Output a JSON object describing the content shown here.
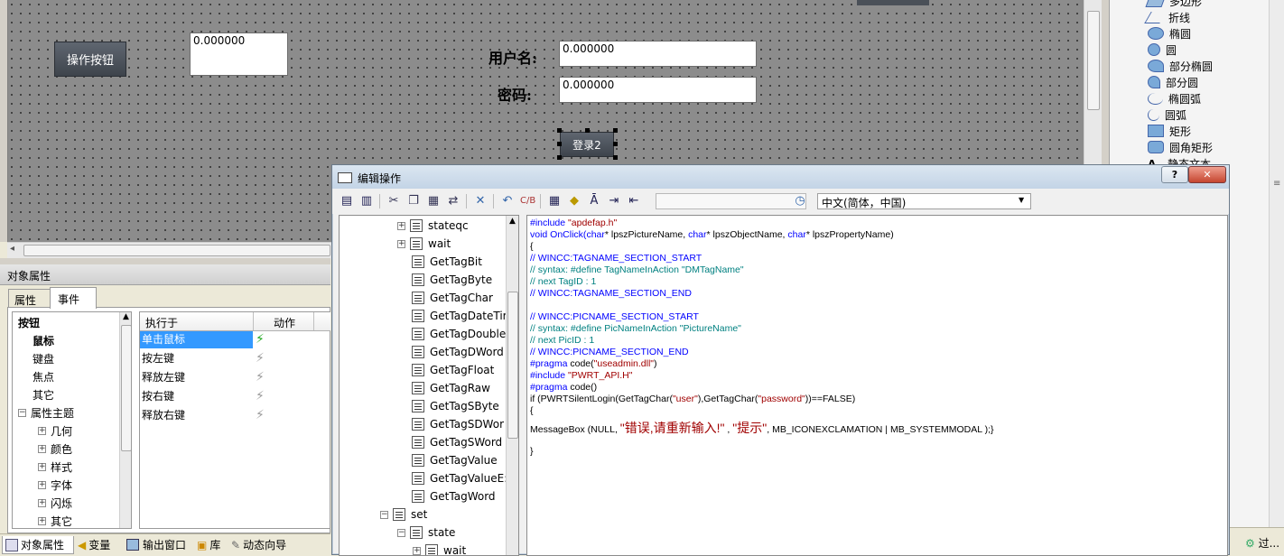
{
  "canvas": {
    "op_button_label": "操作按钮",
    "value_box": "0.000000",
    "username_label": "用户名:",
    "username_value": "0.000000",
    "password_label": "密码:",
    "password_value": "0.000000",
    "login_button_label": "登录2"
  },
  "toolbox": {
    "items": [
      {
        "label": "多边形",
        "icon": "polygon-icon"
      },
      {
        "label": "折线",
        "icon": "polyline-icon"
      },
      {
        "label": "椭圆",
        "icon": "ellipse-icon"
      },
      {
        "label": "圆",
        "icon": "circle-icon"
      },
      {
        "label": "部分椭圆",
        "icon": "partial-ellipse-icon"
      },
      {
        "label": "部分圆",
        "icon": "partial-circle-icon"
      },
      {
        "label": "椭圆弧",
        "icon": "elliptic-arc-icon"
      },
      {
        "label": "圆弧",
        "icon": "arc-icon"
      },
      {
        "label": "矩形",
        "icon": "rectangle-icon"
      },
      {
        "label": "圆角矩形",
        "icon": "rounded-rectangle-icon"
      },
      {
        "label": "静态文本",
        "icon": "static-text-icon"
      }
    ]
  },
  "properties": {
    "panel_title": "对象属性",
    "tabs": [
      "属性",
      "事件"
    ],
    "active_tab": "事件",
    "tree": [
      {
        "label": "按钮",
        "level": 0
      },
      {
        "label": "鼠标",
        "level": 1
      },
      {
        "label": "键盘",
        "level": 1
      },
      {
        "label": "焦点",
        "level": 1
      },
      {
        "label": "其它",
        "level": 1
      },
      {
        "label": "属性主题",
        "level": 1
      },
      {
        "label": "几何",
        "level": 2
      },
      {
        "label": "颜色",
        "level": 2
      },
      {
        "label": "样式",
        "level": 2
      },
      {
        "label": "字体",
        "level": 2
      },
      {
        "label": "闪烁",
        "level": 2
      },
      {
        "label": "其它",
        "level": 2
      }
    ],
    "table_headers": [
      "执行于",
      "动作"
    ],
    "rows": [
      "单击鼠标",
      "按左键",
      "释放左键",
      "按右键",
      "释放右键"
    ],
    "selected_row": "单击鼠标"
  },
  "bottom_tabs": [
    "对象属性",
    "变量",
    "输出窗口",
    "库",
    "动态向导"
  ],
  "bottom_right": "过...",
  "dialog": {
    "title": "编辑操作",
    "help_button": "?",
    "close_button": "✕",
    "language_select": "中文(简体，中国)",
    "tree_items": [
      {
        "label": "stateqc",
        "type": "folder"
      },
      {
        "label": "wait",
        "type": "folder"
      },
      {
        "label": "GetTagBit",
        "type": "fn"
      },
      {
        "label": "GetTagByte",
        "type": "fn"
      },
      {
        "label": "GetTagChar",
        "type": "fn"
      },
      {
        "label": "GetTagDateTir",
        "type": "fn"
      },
      {
        "label": "GetTagDouble",
        "type": "fn"
      },
      {
        "label": "GetTagDWord",
        "type": "fn"
      },
      {
        "label": "GetTagFloat",
        "type": "fn"
      },
      {
        "label": "GetTagRaw",
        "type": "fn"
      },
      {
        "label": "GetTagSByte",
        "type": "fn"
      },
      {
        "label": "GetTagSDWor",
        "type": "fn"
      },
      {
        "label": "GetTagSWord",
        "type": "fn"
      },
      {
        "label": "GetTagValue",
        "type": "fn"
      },
      {
        "label": "GetTagValueE:",
        "type": "fn"
      },
      {
        "label": "GetTagWord",
        "type": "fn"
      },
      {
        "label": "set",
        "type": "folder-open"
      },
      {
        "label": "state",
        "type": "folder-open"
      },
      {
        "label": "wait",
        "type": "folder"
      }
    ],
    "code_lines": [
      [
        {
          "t": "#include ",
          "c": "kw"
        },
        {
          "t": "\"apdefap.h\"",
          "c": "st"
        }
      ],
      [
        {
          "t": "void OnClick(",
          "c": "kw"
        },
        {
          "t": "char",
          "c": "kw"
        },
        {
          "t": "* lpszPictureName, ",
          "c": ""
        },
        {
          "t": "char",
          "c": "kw"
        },
        {
          "t": "* lpszObjectName, ",
          "c": ""
        },
        {
          "t": "char",
          "c": "kw"
        },
        {
          "t": "* lpszPropertyName)",
          "c": ""
        }
      ],
      [
        {
          "t": "{",
          "c": ""
        }
      ],
      [
        {
          "t": "// WINCC:TAGNAME_SECTION_START",
          "c": "kw"
        }
      ],
      [
        {
          "t": "// syntax: #define TagNameInAction \"DMTagName\"",
          "c": "cm"
        }
      ],
      [
        {
          "t": "// next TagID : 1",
          "c": "cm"
        }
      ],
      [
        {
          "t": "// WINCC:TAGNAME_SECTION_END",
          "c": "kw"
        }
      ],
      [
        {
          "t": "",
          "c": ""
        }
      ],
      [
        {
          "t": "// WINCC:PICNAME_SECTION_START",
          "c": "kw"
        }
      ],
      [
        {
          "t": "// syntax: #define PicNameInAction \"PictureName\"",
          "c": "cm"
        }
      ],
      [
        {
          "t": "// next PicID : 1",
          "c": "cm"
        }
      ],
      [
        {
          "t": "// WINCC:PICNAME_SECTION_END",
          "c": "kw"
        }
      ],
      [
        {
          "t": "#pragma ",
          "c": "kw"
        },
        {
          "t": "code(",
          "c": ""
        },
        {
          "t": "\"useadmin.dll\"",
          "c": "st"
        },
        {
          "t": ")",
          "c": ""
        }
      ],
      [
        {
          "t": "#include ",
          "c": "kw"
        },
        {
          "t": "\"PWRT_API.H\"",
          "c": "st"
        }
      ],
      [
        {
          "t": "#pragma ",
          "c": "kw"
        },
        {
          "t": "code()",
          "c": ""
        }
      ],
      [
        {
          "t": "if (PWRTSilentLogin(GetTagChar(",
          "c": ""
        },
        {
          "t": "\"user\"",
          "c": "st"
        },
        {
          "t": "),GetTagChar(",
          "c": ""
        },
        {
          "t": "\"password\"",
          "c": "st"
        },
        {
          "t": "))==FALSE)",
          "c": ""
        }
      ],
      [
        {
          "t": "{",
          "c": ""
        }
      ],
      [
        {
          "t": "MessageBox (NULL, ",
          "c": ""
        },
        {
          "t": "\"错误,请重新输入!\"",
          "c": "zh"
        },
        {
          "t": " , ",
          "c": ""
        },
        {
          "t": "\"提示\"",
          "c": "zh"
        },
        {
          "t": ", MB_ICONEXCLAMATION | MB_SYSTEMMODAL );}",
          "c": ""
        }
      ],
      [
        {
          "t": "",
          "c": ""
        }
      ],
      [
        {
          "t": "}",
          "c": ""
        }
      ]
    ]
  },
  "colors": {
    "canvas_bg": "#8c8c8c",
    "button_dark": "#4a5058",
    "selection_blue": "#3399ff",
    "keyword_blue": "#0000ff",
    "comment_teal": "#008080",
    "string_red": "#a00000"
  }
}
